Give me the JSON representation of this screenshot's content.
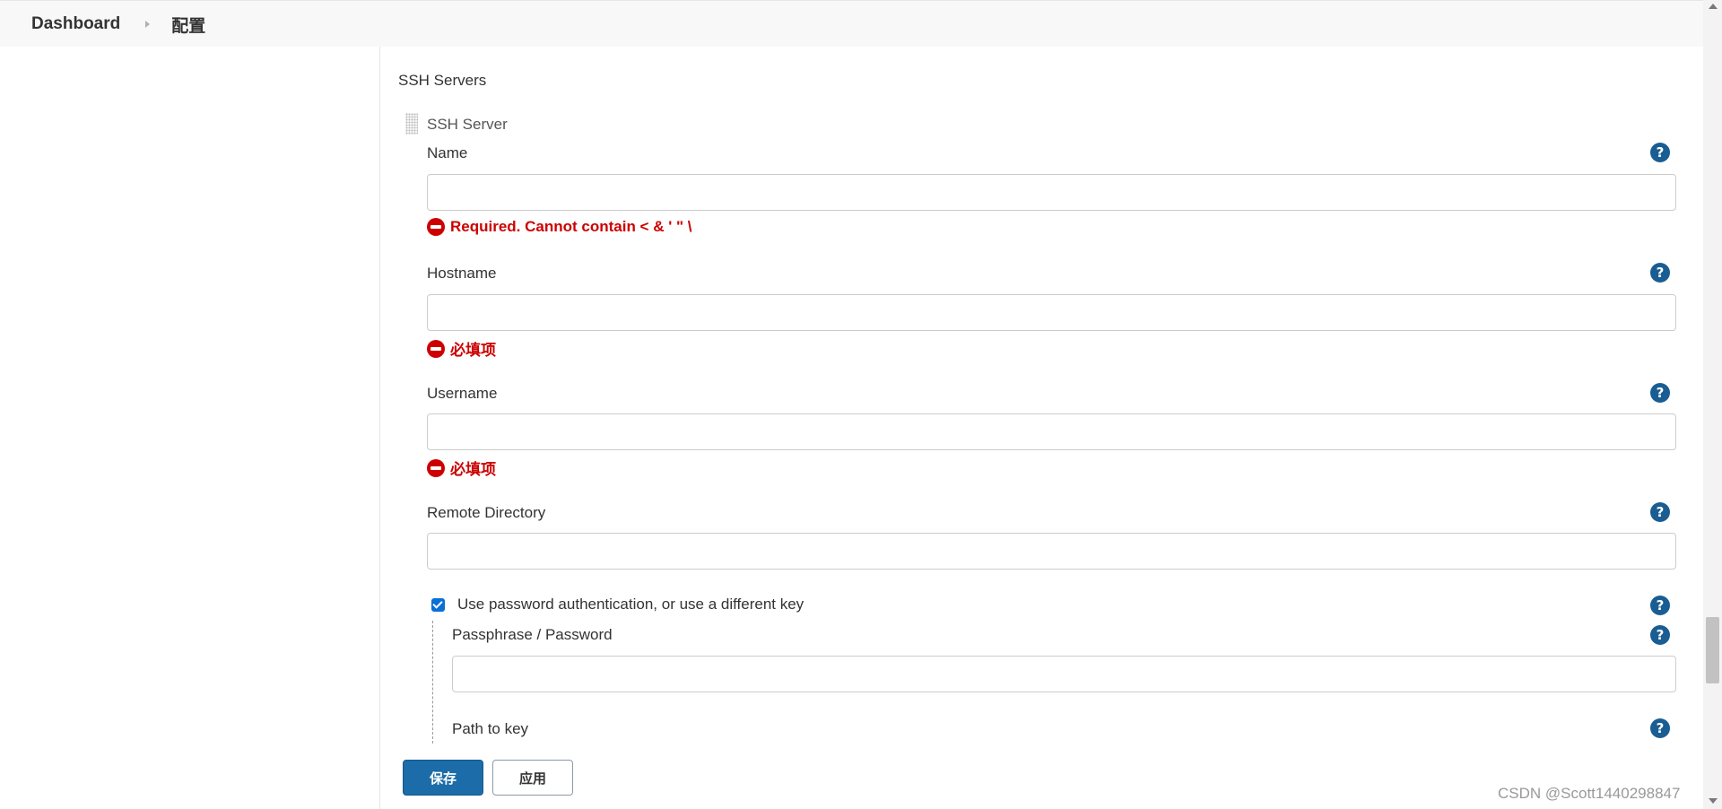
{
  "breadcrumb": {
    "dashboard": "Dashboard",
    "current": "配置"
  },
  "section": {
    "title": "SSH Servers",
    "block_title": "SSH Server"
  },
  "fields": {
    "name": {
      "label": "Name",
      "value": "",
      "error": "Required. Cannot contain < & ' \" \\"
    },
    "hostname": {
      "label": "Hostname",
      "value": "",
      "error": "必填项"
    },
    "username": {
      "label": "Username",
      "value": "",
      "error": "必填项"
    },
    "remote_directory": {
      "label": "Remote Directory",
      "value": ""
    },
    "use_password": {
      "label": "Use password authentication, or use a different key",
      "checked": true
    },
    "passphrase": {
      "label": "Passphrase / Password",
      "value": ""
    },
    "path_to_key": {
      "label": "Path to key"
    }
  },
  "help_symbol": "?",
  "buttons": {
    "save": "保存",
    "apply": "应用"
  },
  "watermark": "CSDN @Scott1440298847",
  "colors": {
    "primary": "#1b6ca8",
    "error": "#cc0000",
    "help": "#1a5d93"
  }
}
